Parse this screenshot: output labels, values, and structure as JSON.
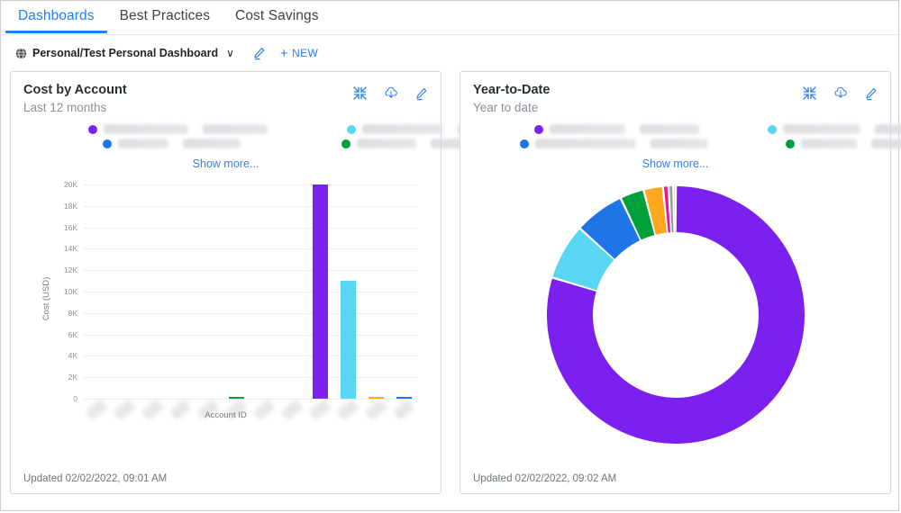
{
  "nav": {
    "tabs": [
      {
        "label": "Dashboards",
        "active": true
      },
      {
        "label": "Best Practices",
        "active": false
      },
      {
        "label": "Cost Savings",
        "active": false
      }
    ]
  },
  "selector": {
    "icon": "globe-icon",
    "dashboard_name": "Personal/Test Personal Dashboard",
    "caret": "∨",
    "edit_icon": "pencil-icon",
    "new_label": "NEW",
    "new_plus": "+"
  },
  "colors": {
    "accent_blue": "#1f7ff0",
    "link_blue": "#3a7de0",
    "purple": "#7c20f0",
    "cyan": "#5ad6f5",
    "blue": "#1f74e8",
    "green": "#00a03c",
    "orange": "#ffa81e",
    "magenta": "#e8199b",
    "grey": "#9b9b9b",
    "red": "#f5481e",
    "border": "#d5d9de",
    "grid": "#eceef1",
    "text_muted": "#8a9099"
  },
  "cards": [
    {
      "title": "Cost by Account",
      "subtitle": "Last 12 months",
      "actions": [
        "collapse-icon",
        "download-icon",
        "edit-icon"
      ],
      "legend": [
        {
          "color": "#7c20f0",
          "redacted": true,
          "w1": 94,
          "w2": 72
        },
        {
          "color": "#5ad6f5",
          "redacted": true,
          "w1": 90,
          "w2": 60
        },
        {
          "color": "#1f74e8",
          "redacted": true,
          "w1": 56,
          "w2": 64
        },
        {
          "color": "#00a03c",
          "redacted": true,
          "w1": 66,
          "w2": 72
        }
      ],
      "show_more": "Show more...",
      "updated": "Updated 02/02/2022, 09:01 AM"
    },
    {
      "title": "Year-to-Date",
      "subtitle": "Year to date",
      "actions": [
        "collapse-icon",
        "download-icon",
        "edit-icon"
      ],
      "legend": [
        {
          "color": "#7c20f0",
          "redacted": true,
          "w1": 84,
          "w2": 66
        },
        {
          "color": "#5ad6f5",
          "redacted": true,
          "w1": 86,
          "w2": 70
        },
        {
          "color": "#1f74e8",
          "redacted": true,
          "w1": 112,
          "w2": 64
        },
        {
          "color": "#00a03c",
          "redacted": true,
          "w1": 62,
          "w2": 74
        }
      ],
      "show_more": "Show more...",
      "updated": "Updated 02/02/2022, 09:02 AM"
    }
  ],
  "chart_data": [
    {
      "type": "bar",
      "title": "Cost by Account",
      "subtitle": "Last 12 months",
      "xlabel": "Account ID",
      "ylabel": "Cost (USD)",
      "ylim": [
        0,
        20000
      ],
      "yticks": [
        0,
        2000,
        4000,
        6000,
        8000,
        10000,
        12000,
        14000,
        16000,
        18000,
        20000
      ],
      "ytick_labels": [
        "0",
        "2K",
        "4K",
        "6K",
        "8K",
        "10K",
        "12K",
        "14K",
        "16K",
        "18K",
        "20K"
      ],
      "grid": true,
      "legend_position": "top",
      "categories": [
        "",
        "",
        "",
        "",
        "",
        "",
        "",
        "",
        "",
        "",
        ""
      ],
      "categories_redacted": true,
      "values": [
        0,
        0,
        0,
        0,
        0,
        120,
        0,
        0,
        20000,
        11000,
        90,
        160
      ],
      "bar_colors": [
        "#cccccc",
        "#cccccc",
        "#cccccc",
        "#cccccc",
        "#cccccc",
        "#00a03c",
        "#cccccc",
        "#cccccc",
        "#7c20f0",
        "#5ad6f5",
        "#ffa81e",
        "#1f74e8"
      ]
    },
    {
      "type": "pie",
      "title": "Year-to-Date",
      "subtitle": "Year to date",
      "donut": true,
      "legend_position": "top",
      "labels": [
        "",
        "",
        "",
        "",
        "",
        "",
        "",
        ""
      ],
      "labels_redacted": true,
      "values": [
        79.7,
        7.0,
        6.3,
        3.0,
        2.4,
        0.7,
        0.6,
        0.3
      ],
      "colors": [
        "#7c20f0",
        "#5ad6f5",
        "#1f74e8",
        "#00a03c",
        "#ffa81e",
        "#e8199b",
        "#9b9b9b",
        "#f5481e"
      ]
    }
  ]
}
